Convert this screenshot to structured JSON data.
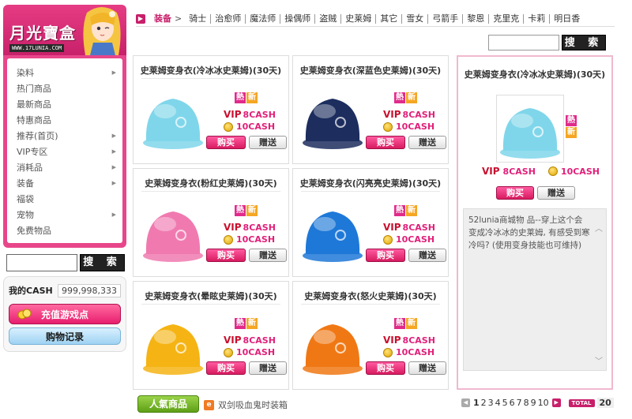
{
  "logo": {
    "title": "月光寶盒",
    "url": "WWW.17LUNIA.COM"
  },
  "sidebar": {
    "items": [
      {
        "label": "染料",
        "arrow": true
      },
      {
        "label": "热门商品",
        "arrow": false
      },
      {
        "label": "最新商品",
        "arrow": false
      },
      {
        "label": "特惠商品",
        "arrow": false
      },
      {
        "label": "推荐(首页)",
        "arrow": true
      },
      {
        "label": "VIP专区",
        "arrow": true
      },
      {
        "label": "消耗品",
        "arrow": true
      },
      {
        "label": "装备",
        "arrow": true
      },
      {
        "label": "福袋",
        "arrow": false
      },
      {
        "label": "宠物",
        "arrow": true
      },
      {
        "label": "免费物品",
        "arrow": false
      }
    ],
    "search_button": "搜 索"
  },
  "cash": {
    "label": "我的CASH",
    "value": "999,998,333",
    "charge_button": "充值游戏点",
    "record_button": "购物记录"
  },
  "nav": {
    "category": "装备",
    "separator": ">",
    "items": [
      "骑士",
      "治愈师",
      "魔法师",
      "操偶师",
      "盗贼",
      "史莱姆",
      "其它",
      "雪女",
      "弓箭手",
      "黎恩",
      "克里克",
      "卡莉",
      "明日香"
    ]
  },
  "top_search": {
    "button": "搜 索"
  },
  "labels": {
    "hot": "熱",
    "new": "新",
    "vip": "VIP",
    "buy": "购买",
    "gift": "赠送"
  },
  "products": [
    {
      "name": "史莱姆变身衣(冷冰冰史莱姆)(30天)",
      "vip_price": "8CASH",
      "cash_price": "10CASH",
      "color": "#7fd6ea"
    },
    {
      "name": "史莱姆变身衣(深蓝色史莱姆)(30天)",
      "vip_price": "8CASH",
      "cash_price": "10CASH",
      "color": "#1c2d5e"
    },
    {
      "name": "史莱姆变身衣(粉红史莱姆)(30天)",
      "vip_price": "8CASH",
      "cash_price": "10CASH",
      "color": "#f07ab0"
    },
    {
      "name": "史莱姆变身衣(闪亮亮史莱姆)(30天)",
      "vip_price": "8CASH",
      "cash_price": "10CASH",
      "color": "#1e78d8"
    },
    {
      "name": "史莱姆变身衣(晕眩史莱姆)(30天)",
      "vip_price": "8CASH",
      "cash_price": "10CASH",
      "color": "#f5b414"
    },
    {
      "name": "史莱姆变身衣(怒火史莱姆)(30天)",
      "vip_price": "8CASH",
      "cash_price": "10CASH",
      "color": "#f07814"
    }
  ],
  "detail": {
    "title": "史莱姆变身衣(冷冰冰史莱姆)(30天)",
    "vip_price": "8CASH",
    "cash_price": "10CASH",
    "description": "52lunia商城物 品--穿上这个会变成冷冰冰的史莱姆, 有感受到寒冷吗? (使用变身技能也可维持)",
    "color": "#7fd6ea"
  },
  "bottom": {
    "popular_button": "人氣商品",
    "promo_text": "双剑吸血鬼时装箱",
    "pages": [
      "1",
      "2",
      "3",
      "4",
      "5",
      "6",
      "7",
      "8",
      "9",
      "10"
    ],
    "current_page": "1",
    "total_label": "TOTAL",
    "total_value": "20"
  }
}
